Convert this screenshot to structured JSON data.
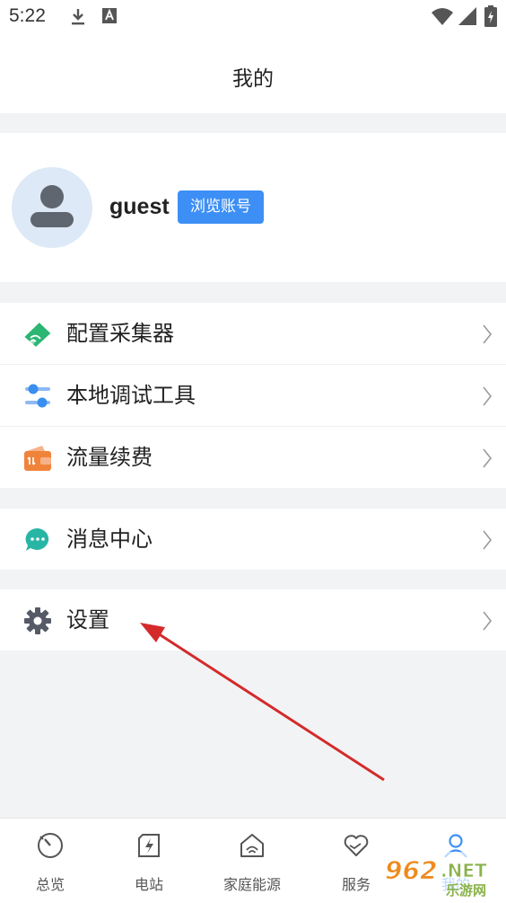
{
  "status_bar": {
    "time": "5:22"
  },
  "header": {
    "title": "我的"
  },
  "profile": {
    "username": "guest",
    "badge": "浏览账号"
  },
  "menu_groups": [
    [
      {
        "label": "配置采集器",
        "icon": "collector-tag-icon",
        "color": "#2bb673"
      },
      {
        "label": "本地调试工具",
        "icon": "sliders-icon",
        "color": "#3a8ef0"
      },
      {
        "label": "流量续费",
        "icon": "wallet-icon",
        "color": "#f0833a"
      }
    ],
    [
      {
        "label": "消息中心",
        "icon": "chat-bubble-icon",
        "color": "#28b5a5"
      }
    ],
    [
      {
        "label": "设置",
        "icon": "gear-icon",
        "color": "#555a66"
      }
    ]
  ],
  "tabbar": {
    "tabs": [
      {
        "label": "总览",
        "icon": "dial-icon"
      },
      {
        "label": "电站",
        "icon": "power-station-icon"
      },
      {
        "label": "家庭能源",
        "icon": "home-energy-icon"
      },
      {
        "label": "服务",
        "icon": "heart-hand-icon"
      },
      {
        "label": "我的",
        "icon": "person-icon",
        "active": true
      }
    ]
  },
  "watermark": {
    "text": "962.NET",
    "subtext": "乐游网"
  },
  "colors": {
    "accent": "#3d8ff5",
    "annotation_arrow": "#d42a2a"
  }
}
